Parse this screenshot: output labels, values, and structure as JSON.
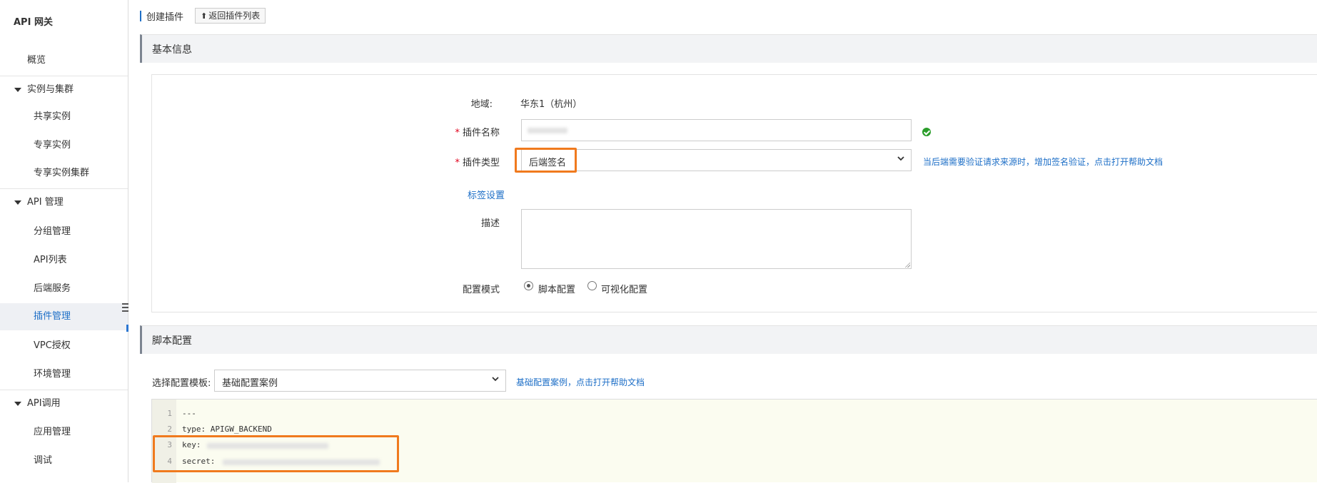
{
  "sidebar": {
    "title": "API 网关",
    "overview": "概览",
    "groups": [
      {
        "label": "实例与集群",
        "items": [
          "共享实例",
          "专享实例",
          "专享实例集群"
        ]
      },
      {
        "label": "API 管理",
        "items": [
          "分组管理",
          "API列表",
          "后端服务",
          "插件管理",
          "VPC授权",
          "环境管理"
        ]
      },
      {
        "label": "API调用",
        "items": [
          "应用管理",
          "调试"
        ]
      }
    ],
    "active_item": "插件管理"
  },
  "header": {
    "title": "创建插件",
    "back_label": "返回插件列表"
  },
  "basic_info": {
    "section_title": "基本信息",
    "region_label": "地域:",
    "region_value": "华东1（杭州）",
    "name_label": "插件名称",
    "type_label": "插件类型",
    "type_value": "后端签名",
    "type_help": "当后端需要验证请求来源时，增加签名验证，点击打开帮助文档",
    "tag_link": "标签设置",
    "desc_label": "描述",
    "mode_label": "配置模式",
    "mode_options": [
      "脚本配置",
      "可视化配置"
    ],
    "mode_selected": "脚本配置",
    "required_mark": "*"
  },
  "script_config": {
    "section_title": "脚本配置",
    "template_label": "选择配置模板:",
    "template_value": "基础配置案例",
    "template_help": "基础配置案例，点击打开帮助文档",
    "code_lines": [
      {
        "num": "1",
        "text": "---"
      },
      {
        "num": "2",
        "text": "type: APIGW_BACKEND"
      },
      {
        "num": "3",
        "text": "key:"
      },
      {
        "num": "4",
        "text": "secret:"
      }
    ]
  },
  "colors": {
    "accent": "#1e6fc7",
    "highlight": "#f07a1e",
    "success": "#2a9d2a",
    "required": "#e0001b"
  }
}
